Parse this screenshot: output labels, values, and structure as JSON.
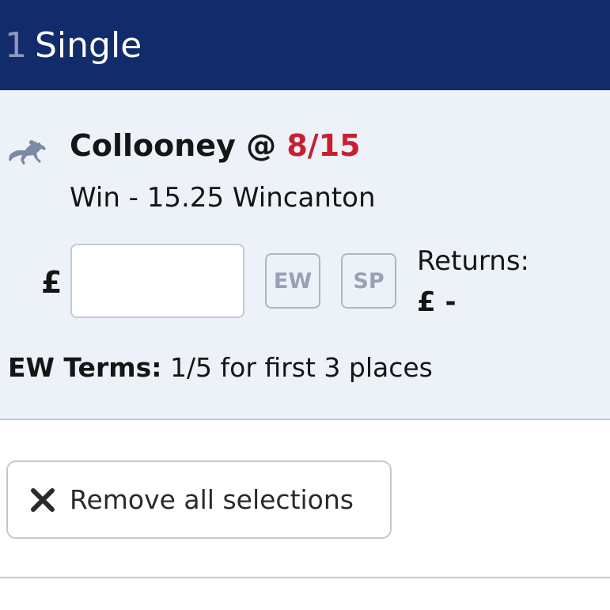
{
  "header": {
    "count": "1",
    "title": "Single"
  },
  "selection": {
    "icon": "horse-racing-icon",
    "name": "Collooney @ ",
    "odds": "8/15",
    "market": "Win - 15.25 Wincanton",
    "currency": "£",
    "stake_value": "",
    "ew_label": "EW",
    "sp_label": "SP",
    "returns_label": "Returns:",
    "returns_value": "£ -",
    "ew_terms_label": "EW Terms:",
    "ew_terms_value": " 1/5 for first 3 places"
  },
  "actions": {
    "remove_all_label": "Remove all selections",
    "remove_icon": "close-icon"
  },
  "colors": {
    "header_bg": "#122b6b",
    "odds": "#c8202f",
    "slip_bg": "#edf2f9"
  }
}
